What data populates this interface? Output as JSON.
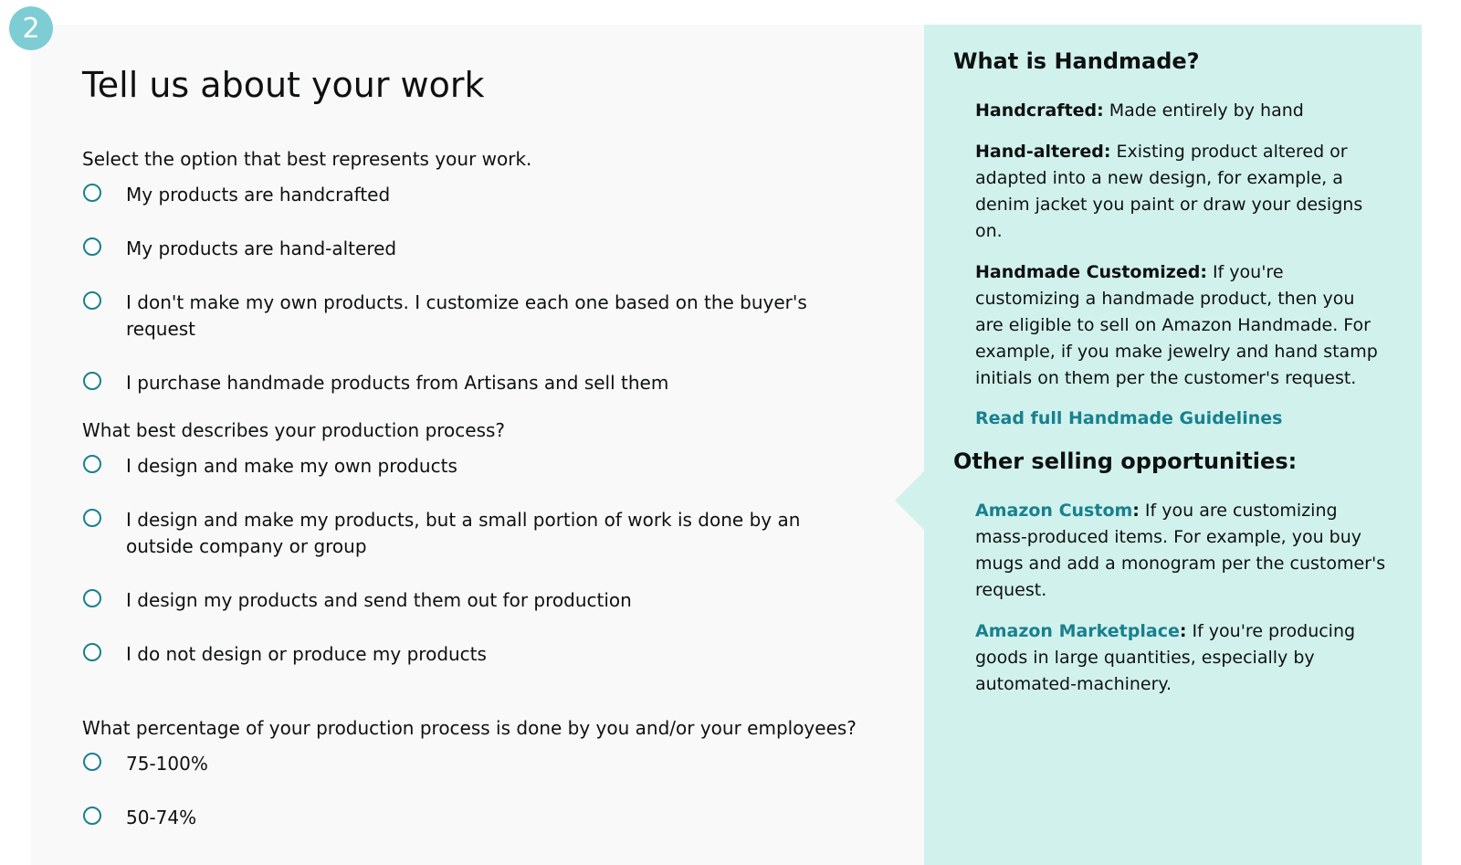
{
  "step": {
    "number": "2",
    "badge_color": "#7ecdd5"
  },
  "page": {
    "title": "Tell us about your work"
  },
  "questions": [
    {
      "label": "Select the option that best represents your work.",
      "options": [
        "My products are handcrafted",
        "My products are hand-altered",
        "I don't make my own products. I customize each one based on the buyer's request",
        "I purchase handmade products from Artisans and sell them"
      ]
    },
    {
      "label": "What best describes your production process?",
      "options": [
        "I design and make my own products",
        "I design and make my products, but a small portion of work is done by an outside company or group",
        "I design my products and send them out for production",
        "I do not design or produce my products"
      ]
    },
    {
      "label": "What percentage of your production process is done by you and/or your employees?",
      "options": [
        "75-100%",
        "50-74%"
      ]
    }
  ],
  "sidebar": {
    "what_is_heading": "What is Handmade?",
    "definitions": [
      {
        "term": "Handcrafted",
        "text": "Made entirely by hand"
      },
      {
        "term": "Hand-altered",
        "text": "Existing product altered or adapted into a new design, for example, a denim jacket you paint or draw your designs on."
      },
      {
        "term": "Handmade Customized",
        "text": "If you're customizing a handmade product, then you are eligible to sell on Amazon Handmade. For example, if you make jewelry and hand stamp initials on them per the customer's request."
      }
    ],
    "guidelines_link": "Read full Handmade Guidelines",
    "other_heading": "Other selling opportunities:",
    "opportunities": [
      {
        "term": "Amazon Custom",
        "text": "If you are customizing mass-produced items. For example, you buy mugs and add a monogram per the customer's request."
      },
      {
        "term": "Amazon Marketplace",
        "text": "If you're producing goods in large quantities, especially by automated-machinery."
      }
    ]
  },
  "colors": {
    "accent": "#19808f",
    "sidebar_bg": "#d1f2ec",
    "form_bg": "#f9f9f9"
  }
}
